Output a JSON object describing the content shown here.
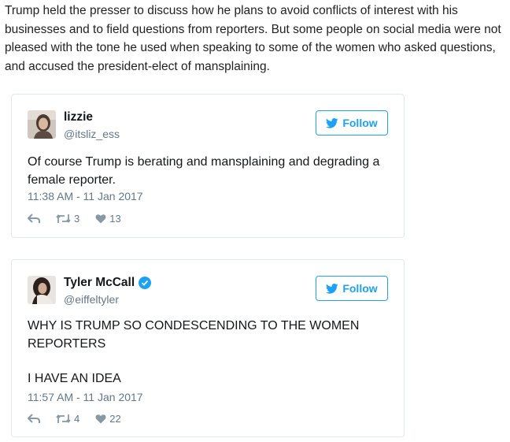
{
  "article": {
    "paragraph": "Trump held the presser to discuss how he plans to avoid conflicts of interest with his businesses and to field questions from reporters. But some people on social media were not pleased with the tone he used when speaking to some of the women who asked questions, and accused the president-elect of mansplaining."
  },
  "tweets": [
    {
      "name": "lizzie",
      "handle": "@itsliz_ess",
      "verified": false,
      "follow_label": "Follow",
      "text": "Of course Trump is berating and mansplaining and degrading a female reporter.",
      "timestamp": "11:38 AM - 11 Jan 2017",
      "retweets": "3",
      "likes": "13"
    },
    {
      "name": "Tyler McCall",
      "handle": "@eiffeltyler",
      "verified": true,
      "follow_label": "Follow",
      "text_line1": "WHY IS TRUMP SO CONDESCENDING TO THE WOMEN REPORTERS",
      "text_line2": "I HAVE AN IDEA",
      "timestamp": "11:57 AM - 11 Jan 2017",
      "retweets": "4",
      "likes": "22"
    }
  ],
  "colors": {
    "twitter_blue": "#1da1f2",
    "muted_text": "#657786",
    "border": "#e1e8ed"
  },
  "icons": [
    "bird-icon",
    "reply-icon",
    "retweet-icon",
    "heart-icon",
    "verified-badge-icon"
  ]
}
